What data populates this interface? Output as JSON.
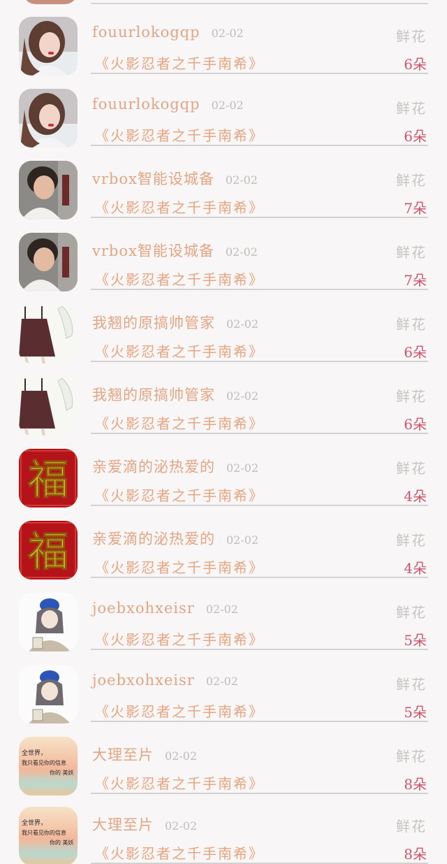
{
  "items": [
    {
      "name": "fouurlokogqp",
      "date": "02-02",
      "gift": "《火影忍者之千手南希》",
      "type": "鲜花",
      "count": "6朵",
      "avatar_icon": "girl-photo-icon"
    },
    {
      "name": "fouurlokogqp",
      "date": "02-02",
      "gift": "《火影忍者之千手南希》",
      "type": "鲜花",
      "count": "6朵",
      "avatar_icon": "girl-photo-icon"
    },
    {
      "name": "vrbox智能设城备",
      "date": "02-02",
      "gift": "《火影忍者之千手南希》",
      "type": "鲜花",
      "count": "7朵",
      "avatar_icon": "boy-photo-icon"
    },
    {
      "name": "vrbox智能设城备",
      "date": "02-02",
      "gift": "《火影忍者之千手南希》",
      "type": "鲜花",
      "count": "7朵",
      "avatar_icon": "boy-photo-icon"
    },
    {
      "name": "我翘的原搞帅管家",
      "date": "02-02",
      "gift": "《火影忍者之千手南希》",
      "type": "鲜花",
      "count": "6朵",
      "avatar_icon": "skirt-illustration-icon"
    },
    {
      "name": "我翘的原搞帅管家",
      "date": "02-02",
      "gift": "《火影忍者之千手南希》",
      "type": "鲜花",
      "count": "6朵",
      "avatar_icon": "skirt-illustration-icon"
    },
    {
      "name": "亲爱滴的泌热爱的",
      "date": "02-02",
      "gift": "《火影忍者之千手南希》",
      "type": "鲜花",
      "count": "4朵",
      "avatar_icon": "fu-character-icon"
    },
    {
      "name": "亲爱滴的泌热爱的",
      "date": "02-02",
      "gift": "《火影忍者之千手南希》",
      "type": "鲜花",
      "count": "4朵",
      "avatar_icon": "fu-character-icon"
    },
    {
      "name": "joebxohxeisr",
      "date": "02-02",
      "gift": "《火影忍者之千手南希》",
      "type": "鲜花",
      "count": "5朵",
      "avatar_icon": "cartoon-girl-icon"
    },
    {
      "name": "joebxohxeisr",
      "date": "02-02",
      "gift": "《火影忍者之千手南希》",
      "type": "鲜花",
      "count": "5朵",
      "avatar_icon": "cartoon-girl-icon"
    },
    {
      "name": "大理至片",
      "date": "02-02",
      "gift": "《火影忍者之千手南希》",
      "type": "鲜花",
      "count": "8朵",
      "avatar_icon": "sunset-text-icon",
      "avatar_text_1": "全世界，",
      "avatar_text_2": "我只看见你的信息",
      "avatar_text_3": "你的 美妖"
    },
    {
      "name": "大理至片",
      "date": "02-02",
      "gift": "《火影忍者之千手南希》",
      "type": "鲜花",
      "count": "8朵",
      "avatar_icon": "sunset-text-icon",
      "avatar_text_1": "全世界，",
      "avatar_text_2": "我只看见你的信息",
      "avatar_text_3": "你的 美妖"
    }
  ],
  "colors": {
    "name": "#e3a583",
    "gift": "#e7a47f",
    "count": "#d0546b",
    "type": "#c8c3c3",
    "date": "#c1bbbb"
  }
}
